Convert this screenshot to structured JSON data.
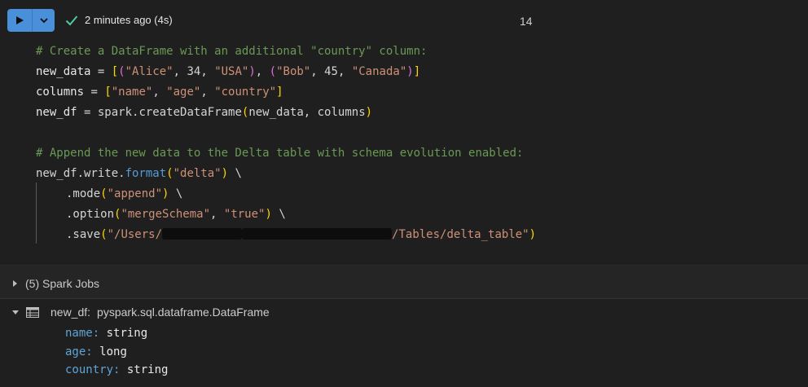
{
  "header": {
    "status_text": "2 minutes ago (4s)",
    "cell_number": "14",
    "colors": {
      "run_button": "#4a8fd9",
      "success": "#4ec9a0"
    }
  },
  "code": {
    "line1_comment": "# Create a DataFrame with an additional \"country\" column:",
    "line2": {
      "var": "new_data",
      "eq": " = ",
      "s1": "\"Alice\"",
      "n1": "34",
      "s2": "\"USA\"",
      "s3": "\"Bob\"",
      "n2": "45",
      "s4": "\"Canada\""
    },
    "line3": {
      "var": "columns",
      "eq": " = ",
      "s1": "\"name\"",
      "s2": "\"age\"",
      "s3": "\"country\""
    },
    "line4": {
      "var": "new_df",
      "eq": " = ",
      "call": "spark.createDataFrame",
      "args": "new_data, columns"
    },
    "line6_comment": "# Append the new data to the Delta table with schema evolution enabled:",
    "line7": {
      "obj": "new_df.write.",
      "fn": "format",
      "arg": "\"delta\"",
      "tail": " \\"
    },
    "line8": {
      "fn": ".mode",
      "arg": "\"append\"",
      "tail": " \\"
    },
    "line9": {
      "fn": ".option",
      "arg1": "\"mergeSchema\"",
      "arg2": "\"true\"",
      "tail": " \\"
    },
    "line10": {
      "fn": ".save",
      "arg_start": "\"/Users/",
      "arg_end": "/Tables/delta_table\""
    }
  },
  "jobs": {
    "label": "(5) Spark Jobs"
  },
  "result": {
    "name": "new_df:",
    "type": "pyspark.sql.dataframe.DataFrame",
    "schema": [
      {
        "key": "name:",
        "value": "string"
      },
      {
        "key": "age:",
        "value": "long"
      },
      {
        "key": "country:",
        "value": "string"
      }
    ]
  }
}
